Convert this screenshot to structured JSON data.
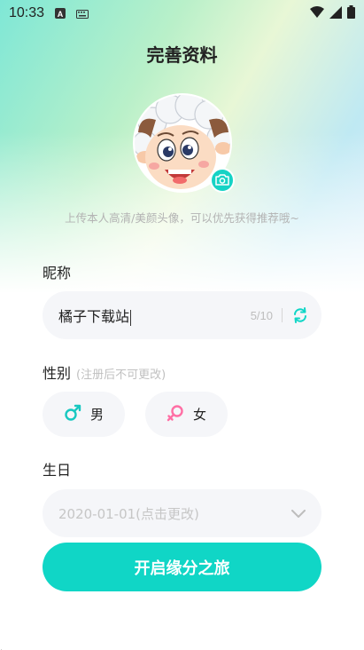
{
  "status_bar": {
    "time": "10:33",
    "icons": [
      "a-icon",
      "keyboard-icon",
      "wifi-icon",
      "signal-icon",
      "battery-icon"
    ]
  },
  "page": {
    "title": "完善资料",
    "avatar_hint": "上传本人高清/美颜头像，可以优先获得推荐哦~"
  },
  "nickname": {
    "label": "昵称",
    "value": "橘子下载站",
    "count": "5/10",
    "refresh_icon": "refresh-icon"
  },
  "gender": {
    "label": "性别",
    "note": "(注册后不可更改)",
    "options": [
      {
        "label": "男",
        "icon": "male-icon",
        "color": "#18c8c0"
      },
      {
        "label": "女",
        "icon": "female-icon",
        "color": "#ff6fa5"
      }
    ]
  },
  "birthday": {
    "label": "生日",
    "placeholder": "2020-01-01(点击更改)"
  },
  "submit": {
    "label": "开启缘分之旅"
  },
  "colors": {
    "accent": "#10d6c6",
    "field_bg": "#f5f6f9",
    "hint_text": "#b3b3b3"
  }
}
